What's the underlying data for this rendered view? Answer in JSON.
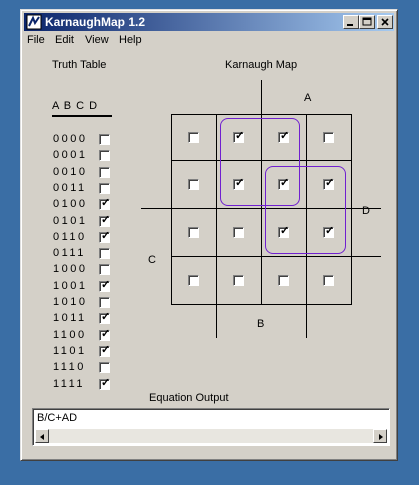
{
  "window": {
    "title": "KarnaughMap 1.2",
    "controls": {
      "minimize": "minimize-icon",
      "maximize": "maximize-icon",
      "close": "close-icon"
    }
  },
  "menu": [
    "File",
    "Edit",
    "View",
    "Help"
  ],
  "truth_table": {
    "title": "Truth Table",
    "header": "A B C D",
    "rows": [
      {
        "bits": "0000",
        "checked": false
      },
      {
        "bits": "0001",
        "checked": false
      },
      {
        "bits": "0010",
        "checked": false
      },
      {
        "bits": "0011",
        "checked": false
      },
      {
        "bits": "0100",
        "checked": true
      },
      {
        "bits": "0101",
        "checked": true
      },
      {
        "bits": "0110",
        "checked": true
      },
      {
        "bits": "0111",
        "checked": false
      },
      {
        "bits": "1000",
        "checked": false
      },
      {
        "bits": "1001",
        "checked": true
      },
      {
        "bits": "1010",
        "checked": false
      },
      {
        "bits": "1011",
        "checked": true
      },
      {
        "bits": "1100",
        "checked": true
      },
      {
        "bits": "1101",
        "checked": true
      },
      {
        "bits": "1110",
        "checked": false
      },
      {
        "bits": "1111",
        "checked": true
      }
    ]
  },
  "kmap": {
    "title": "Karnaugh Map",
    "label_a": "A",
    "label_b": "B",
    "label_c": "C",
    "label_d": "D",
    "cells": [
      [
        false,
        true,
        true,
        false
      ],
      [
        false,
        true,
        true,
        true
      ],
      [
        false,
        false,
        true,
        true
      ],
      [
        false,
        false,
        false,
        false
      ]
    ]
  },
  "equation": {
    "title": "Equation Output",
    "value": "B/C+AD"
  }
}
